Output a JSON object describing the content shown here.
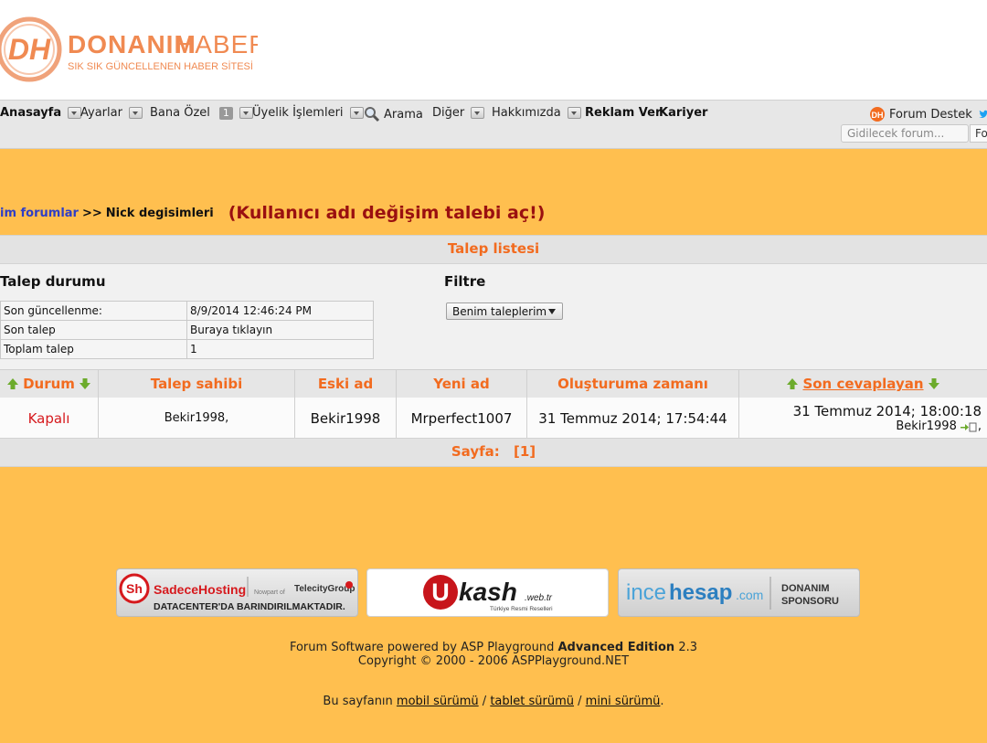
{
  "logo": {
    "brand": "DONANIMHABER",
    "brand_part1": "DONANIM",
    "brand_part2": "HABER",
    "tagline": "SIK SIK GÜNCELLENEN HABER SİTESİ",
    "initials": "DH"
  },
  "nav": {
    "items": [
      {
        "label": "Anasayfa"
      },
      {
        "label": "Ayarlar"
      },
      {
        "label": "Bana Özel",
        "badge": "1"
      },
      {
        "label": "Üyelik İşlemleri"
      },
      {
        "label": "Arama"
      },
      {
        "label": "Diğer"
      },
      {
        "label": "Hakkımızda"
      },
      {
        "label": "Reklam Ver"
      },
      {
        "label": "Kariyer"
      }
    ],
    "forum_support": "Forum Destek",
    "search_placeholder": "Gidilecek forum...",
    "search_button": "Fo"
  },
  "breadcrumb": {
    "link": "im forumlar",
    "separator": ">>",
    "current": "Nick degisimleri",
    "action": "(Kullanıcı adı değişim talebi aç!)"
  },
  "panel": {
    "title": "Talep listesi",
    "status_title": "Talep durumu",
    "status_rows": [
      {
        "label": "Son güncellenme:",
        "value": "8/9/2014 12:46:24 PM"
      },
      {
        "label": "Son talep",
        "value": "Buraya tıklayın"
      },
      {
        "label": "Toplam talep",
        "value": "1"
      }
    ],
    "filter_title": "Filtre",
    "filter_selected": "Benim taleplerim"
  },
  "table": {
    "headers": [
      "Durum",
      "Talep sahibi",
      "Eski ad",
      "Yeni ad",
      "Oluşturuma zamanı",
      "Son cevaplayan"
    ],
    "row": {
      "durum": "Kapalı",
      "sahibi": "Bekir1998,",
      "eski": "Bekir1998",
      "yeni": "Mrperfect1007",
      "zaman": "31 Temmuz 2014; 17:54:44",
      "son_tarih": "31 Temmuz 2014; 18:00:18",
      "son_kisi": "Bekir1998",
      "son_sep": ","
    },
    "page_label": "Sayfa:",
    "page_current": "[1]"
  },
  "sponsors": {
    "s1_name": "SadeceHosting",
    "s1_partner": "Nowpart of",
    "s1_group": "TelecityGroup",
    "s1_tag": "DATACENTER'DA BARINDIRILMAKTADIR.",
    "s1_logo": "Sh",
    "s2_name": "kash",
    "s2_u": "U",
    "s2_suffix": ".web.tr",
    "s2_tag": "Türkiye Resmi Reselleri",
    "s3_name_a": "ince",
    "s3_name_b": "hesap",
    "s3_name_c": ".com",
    "s3_tag1": "DONANIM",
    "s3_tag2": "SPONSORU"
  },
  "footer": {
    "powered_prefix": "Forum Software powered by ASP Playground",
    "edition": "Advanced Edition",
    "version": "2.3",
    "copyright": "Copyright © 2000 - 2006 ASPPlayground.NET",
    "versions_prefix": "Bu sayfanın",
    "mobile": "mobil sürümü",
    "tablet": "tablet sürümü",
    "mini": "mini sürümü",
    "slash": "/",
    "period": "."
  },
  "colors": {
    "page_bg": "#ffbf4f",
    "accent": "#f26b1f",
    "closed": "#d6191d",
    "link": "#2e3ec6",
    "action": "#9a1010"
  }
}
